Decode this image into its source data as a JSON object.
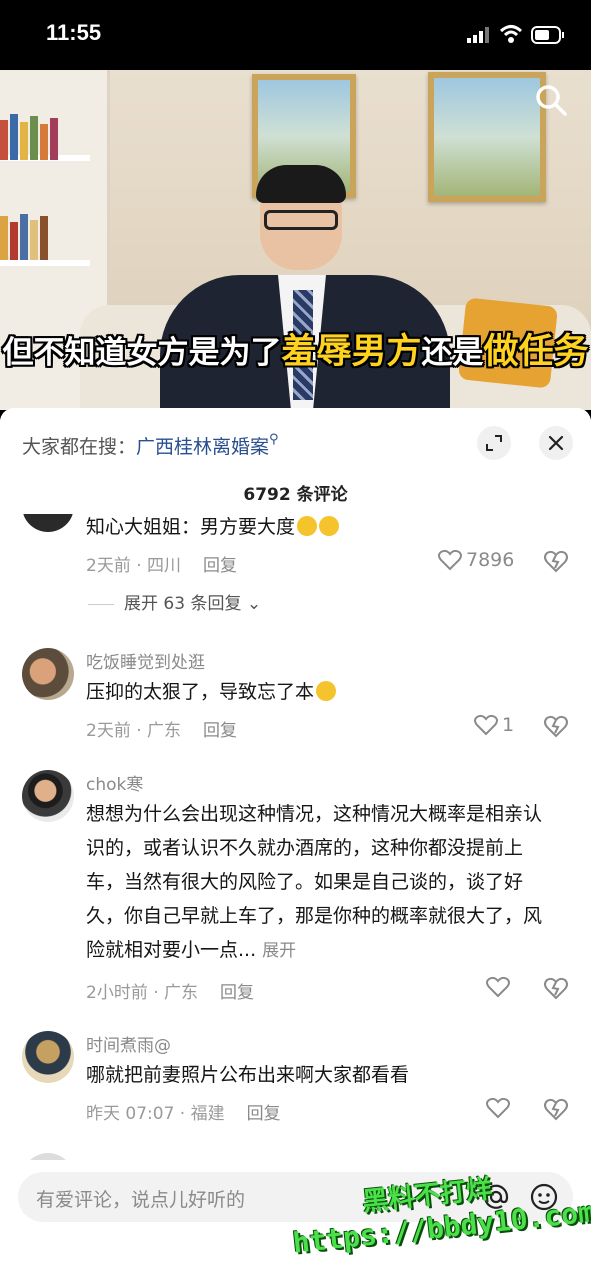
{
  "status_bar": {
    "time": "11:55"
  },
  "video": {
    "subtitle_part1": "但不知道女方是为了",
    "subtitle_highlight1": "羞辱男方",
    "subtitle_part2": "还是",
    "subtitle_highlight2": "做任务"
  },
  "sheet": {
    "hot_search_label": "大家都在搜：",
    "hot_search_term": "广西桂林离婚案",
    "comment_count": "6792 条评论"
  },
  "comments": [
    {
      "username": "",
      "text": "知心大姐姐：男方要大度",
      "time_location": "2天前 · 四川",
      "reply_label": "回复",
      "likes": "7896",
      "expand_label": "展开 63 条回复"
    },
    {
      "username": "吃饭睡觉到处逛",
      "text": "压抑的太狠了，导致忘了本",
      "time_location": "2天前 · 广东",
      "reply_label": "回复",
      "likes": "1"
    },
    {
      "username": "chok寒",
      "text": "想想为什么会出现这种情况，这种情况大概率是相亲认识的，或者认识不久就办酒席的，这种你都没提前上车，当然有很大的风险了。如果是自己谈的，谈了好久，你自己早就上车了，那是你种的概率就很大了，风险就相对要小一点...",
      "more_label": "展开",
      "time_location": "2小时前 · 广东",
      "reply_label": "回复",
      "likes": ""
    },
    {
      "username": "时间煮雨@",
      "text": "哪就把前妻照片公布出来啊大家都看看",
      "time_location": "昨天 07:07 · 福建",
      "reply_label": "回复",
      "likes": ""
    }
  ],
  "input": {
    "placeholder": "有爱评论，说点儿好听的"
  },
  "watermark": {
    "line1": "黑料不打烊",
    "line2": "https://bbdy10.com"
  }
}
